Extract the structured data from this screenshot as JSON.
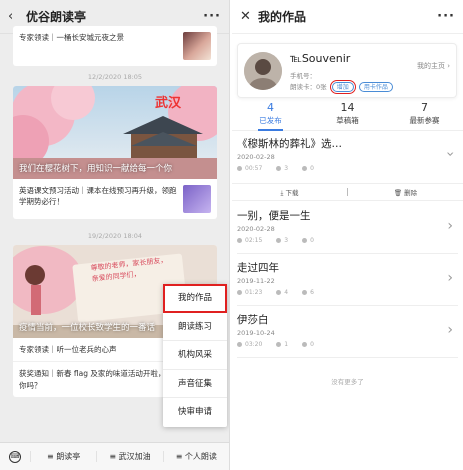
{
  "left": {
    "header": {
      "back_icon": "‹",
      "title": "优谷朗读亭",
      "more": "···"
    },
    "messages": {
      "top_text": "专家领读｜一桶长安城元夜之景",
      "time1": "12/2/2020 18:05",
      "banner1_caption": "我们在樱花树下，用知识一献给每一个你",
      "banner1_overlay": "武汉",
      "row2_text": "英语课文预习活动｜课本在线预习再升级，领跑学期势必行！",
      "time2": "19/2/2020 18:04",
      "banner2_caption": "疫情当前，一位校长致学生的一番话",
      "banner2_overlay": "尊敬的老师，家长朋友，亲爱的同学们，",
      "row3_text": "专家领读｜听一位老兵的心声",
      "row4_text": "获奖通知｜新春 flag 及家的味道活动开啦，快来看看有你吗？"
    },
    "popup": [
      "我的作品",
      "朗读练习",
      "机构风采",
      "声音征集",
      "快审申请"
    ],
    "bottom": {
      "kb_icon": "keyboard-icon",
      "tabs": [
        "≡ 朗读亭",
        "≡ 武汉加油",
        "≡ 个人朗读"
      ]
    }
  },
  "right": {
    "header": {
      "close_icon": "✕",
      "title": "我的作品",
      "more": "···"
    },
    "profile": {
      "name": "℡Souvenir",
      "phone": "手机号：",
      "card": "朗读卡：0张",
      "add_btn": "增加",
      "use_btn": "用卡作品",
      "home_link": "我的主页 ›"
    },
    "tabs": [
      {
        "num": "4",
        "label": "已发布"
      },
      {
        "num": "14",
        "label": "草稿箱"
      },
      {
        "num": "7",
        "label": "最新参赛"
      }
    ],
    "works": [
      {
        "title": "《穆斯林的葬礼》选…",
        "date": "2020-02-28",
        "dur": "00:57",
        "plays": "3",
        "likes": "0"
      },
      {
        "title": "一别，便是一生",
        "date": "2020-02-28",
        "dur": "02:15",
        "plays": "3",
        "likes": "0"
      },
      {
        "title": "走过四年",
        "date": "2019-11-22",
        "dur": "01:23",
        "plays": "4",
        "likes": "6"
      },
      {
        "title": "伊莎白",
        "date": "2019-10-24",
        "dur": "03:20",
        "plays": "1",
        "likes": "0"
      }
    ],
    "actions": {
      "download": "下载",
      "delete": "删除"
    },
    "no_more": "没有更多了"
  }
}
